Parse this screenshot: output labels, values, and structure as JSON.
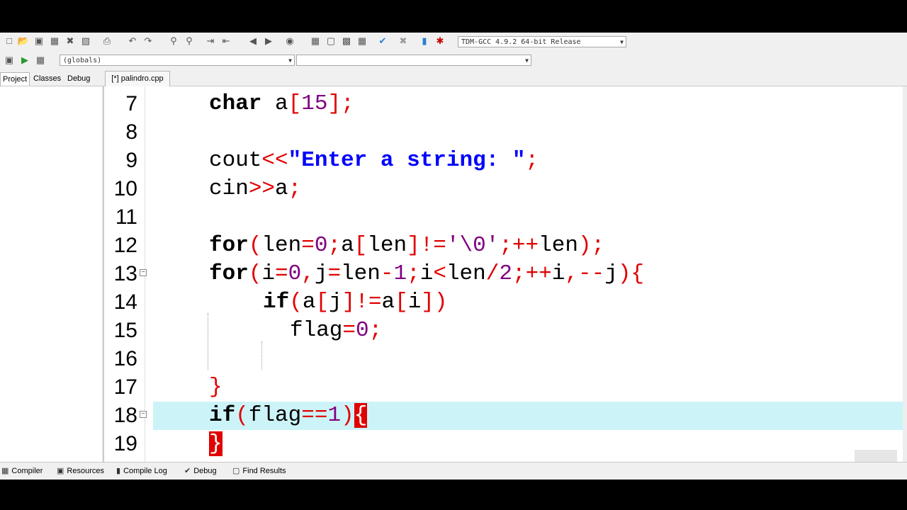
{
  "toolbar": {
    "compiler_select": "TDM-GCC 4.9.2 64-bit Release",
    "icons": [
      "new-file-icon",
      "open-icon",
      "save-icon",
      "save-all-icon",
      "close-icon",
      "close-all-icon",
      "print-icon",
      "undo-icon",
      "redo-icon",
      "find-icon",
      "replace-icon",
      "indent-icon",
      "unindent-icon",
      "goto-back-icon",
      "goto-forward-icon",
      "bookmark-icon",
      "new-project-icon",
      "project-options-icon",
      "new-class-icon",
      "check-icon",
      "stop-icon",
      "chart-icon",
      "debug-icon"
    ]
  },
  "toolbar2": {
    "globals_select": "(globals)",
    "members_select": ""
  },
  "left_tabs": [
    {
      "label": "Project",
      "active": true
    },
    {
      "label": "Classes",
      "active": false
    },
    {
      "label": "Debug",
      "active": false
    }
  ],
  "file_tab": "[*] palindro.cpp",
  "editor": {
    "lines": [
      {
        "num": "7"
      },
      {
        "num": "8"
      },
      {
        "num": "9"
      },
      {
        "num": "10"
      },
      {
        "num": "11"
      },
      {
        "num": "12"
      },
      {
        "num": "13"
      },
      {
        "num": "14"
      },
      {
        "num": "15"
      },
      {
        "num": "16"
      },
      {
        "num": "17"
      },
      {
        "num": "18"
      },
      {
        "num": "19"
      }
    ],
    "highlight_color": "#ccf4f8",
    "code": {
      "l7": {
        "kw": "char",
        "rest": " a",
        "ob": "[",
        "n": "15",
        "cb": "]",
        "semi": ";"
      },
      "l9": {
        "id": "cout",
        "op": "<<",
        "str": "\"Enter a string: \"",
        "semi": ";"
      },
      "l10": {
        "id": "cin",
        "op": ">>",
        "id2": "a",
        "semi": ";"
      },
      "l12": {
        "kw": "for"
      },
      "l13": {
        "kw": "for"
      },
      "l14": {
        "kw": "if"
      },
      "l15": {
        "id": "flag",
        "op": "=",
        "n": "0",
        "semi": ";"
      },
      "l17": {
        "cb": "}"
      },
      "l18": {
        "kw": "if"
      },
      "l19": {
        "cb": "}"
      }
    }
  },
  "bottom_tabs": [
    {
      "label": "Compiler",
      "icon": "compiler-icon"
    },
    {
      "label": "Resources",
      "icon": "resources-icon"
    },
    {
      "label": "Compile Log",
      "icon": "compile-log-icon"
    },
    {
      "label": "Debug",
      "icon": "debug-check-icon"
    },
    {
      "label": "Find Results",
      "icon": "find-results-icon"
    }
  ]
}
